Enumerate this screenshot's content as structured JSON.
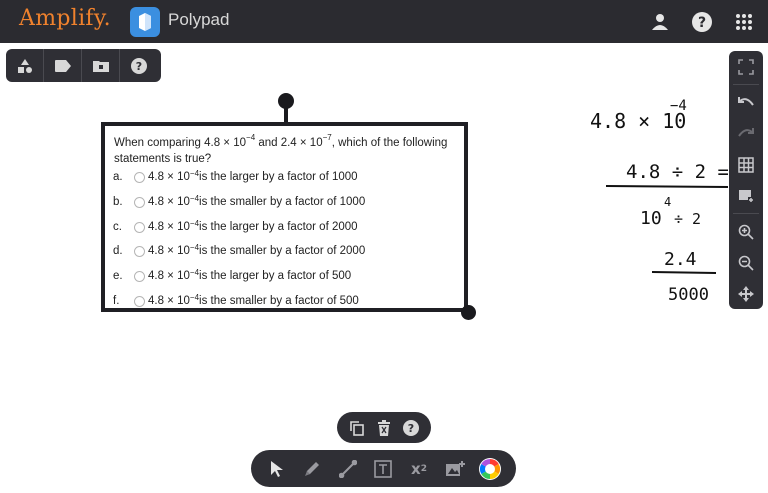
{
  "header": {
    "brand": "Amplify.",
    "app_name": "Polypad",
    "icons": [
      "user-icon",
      "help-icon",
      "apps-grid-icon"
    ]
  },
  "top_left_toolbar": {
    "icons": [
      "shapes-icon",
      "tag-icon",
      "folder-icon",
      "help-icon"
    ]
  },
  "right_toolbar": {
    "icons": [
      "fullscreen-icon",
      "undo-icon",
      "redo-icon",
      "grid-icon",
      "image-layer-icon",
      "zoom-in-icon",
      "zoom-out-icon",
      "pan-icon"
    ]
  },
  "question": {
    "line1_pre": "When comparing 4.8 × 10",
    "line1_exp1": "−4",
    "line1_mid": " and 2.4 × 10",
    "line1_exp2": "−7",
    "line1_post": ", which of the following",
    "line2": "statements is true?",
    "options": [
      {
        "letter": "a.",
        "base": "4.8 × 10",
        "exp": "−4",
        "text": " is the larger by a factor of 1000"
      },
      {
        "letter": "b.",
        "base": "4.8 × 10",
        "exp": "−4",
        "text": " is the smaller by a factor of 1000"
      },
      {
        "letter": "c.",
        "base": "4.8 × 10",
        "exp": "−4",
        "text": " is the larger by a factor of 2000"
      },
      {
        "letter": "d.",
        "base": "4.8 × 10",
        "exp": "−4",
        "text": " is the smaller by a factor of 2000"
      },
      {
        "letter": "e.",
        "base": "4.8 × 10",
        "exp": "−4",
        "text": " is the larger by a factor of 500"
      },
      {
        "letter": "f.",
        "base": "4.8 × 10",
        "exp": "−4",
        "text": " is the smaller by a factor of 500"
      }
    ]
  },
  "handwriting": {
    "line1": "4.8 × 10",
    "line1_exp": "−4",
    "numerator": "4.8 ÷ 2 =",
    "denominator": "10",
    "denominator_exp": "4",
    "denominator_tail": " ÷ 2",
    "result_num": "2.4",
    "result_den": "5000"
  },
  "bottom_small_toolbar": {
    "icons": [
      "copy-icon",
      "trash-icon",
      "help-icon"
    ]
  },
  "bottom_toolbar": {
    "icons": [
      "pointer-icon",
      "pen-icon",
      "line-icon",
      "text-box-icon",
      "equation-icon",
      "image-add-icon",
      "color-wheel-icon"
    ],
    "equation_label": "x",
    "equation_sup": "2"
  },
  "colors": {
    "topbar": "#2b2b30",
    "brand_orange": "#f0822d",
    "toolbar": "#2f2f35",
    "icon_gray": "#9a9aa0"
  }
}
